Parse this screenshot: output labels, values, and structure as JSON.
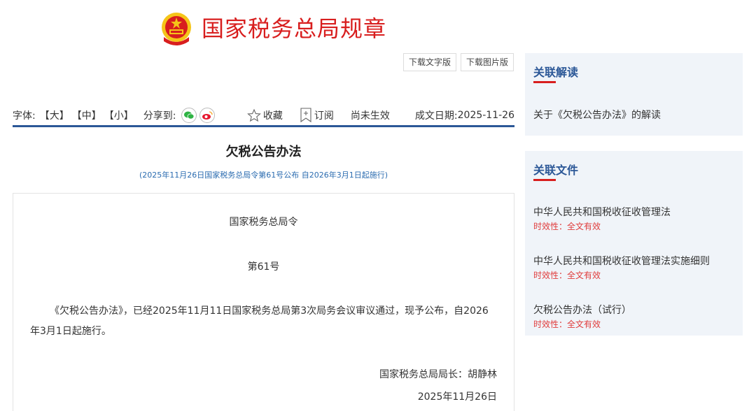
{
  "header": {
    "title": "国家税务总局规章"
  },
  "downloads": {
    "text_version": "下载文字版",
    "image_version": "下载图片版"
  },
  "toolbar": {
    "font_label": "字体:",
    "font_large": "【大】",
    "font_medium": "【中】",
    "font_small": "【小】",
    "share_label": "分享到:",
    "favorite": "收藏",
    "subscribe": "订阅",
    "status": "尚未生效",
    "date_label": "成文日期:",
    "date_value": "2025-11-26"
  },
  "article": {
    "title": "欠税公告办法",
    "subtitle": "(2025年11月26日国家税务总局令第61号公布 自2026年3月1日起施行)",
    "order": "国家税务总局令",
    "number": "第61号",
    "paragraph": "《欠税公告办法》，已经2025年11月11日国家税务总局第3次局务会议审议通过，现予公布，自2026年3月1日起施行。",
    "signature": "国家税务总局局长：胡静林",
    "sign_date": "2025年11月26日"
  },
  "sidebar": {
    "interpretation": {
      "title": "关联解读",
      "items": [
        {
          "label": "关于《欠税公告办法》的解读"
        }
      ]
    },
    "files": {
      "title": "关联文件",
      "items": [
        {
          "label": "中华人民共和国税收征收管理法",
          "validity": "时效性：全文有效"
        },
        {
          "label": "中华人民共和国税收征收管理法实施细则",
          "validity": "时效性：全文有效"
        },
        {
          "label": "欠税公告办法（试行）",
          "validity": "时效性：全文有效"
        }
      ]
    }
  },
  "colors": {
    "brand_red": "#d81e1e",
    "accent_blue": "#2b5797",
    "panel_bg": "#f0f4f9",
    "valid_red": "#e03c3c"
  }
}
